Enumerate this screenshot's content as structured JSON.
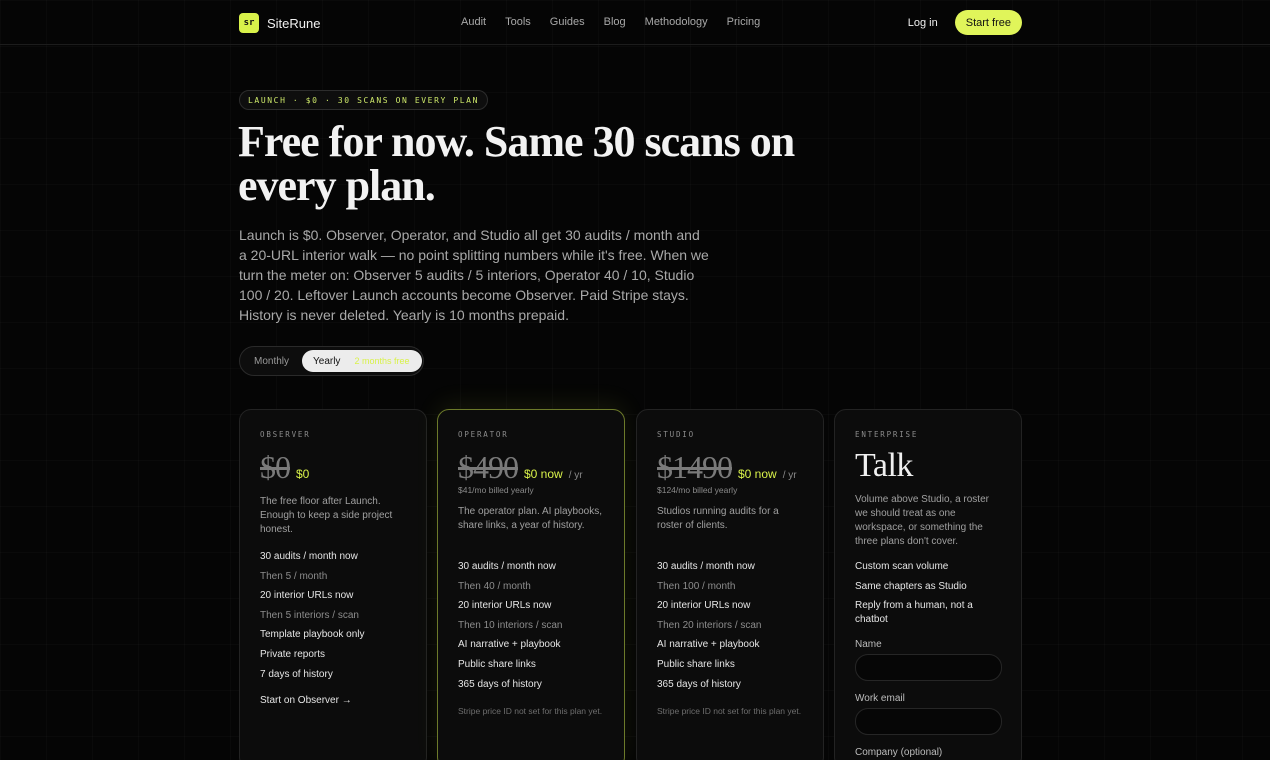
{
  "nav": {
    "logo_text": "sr",
    "brand": "SiteRune",
    "links": [
      "Audit",
      "Tools",
      "Guides",
      "Blog",
      "Methodology",
      "Pricing"
    ],
    "login": "Log in",
    "cta": "Start free"
  },
  "hero": {
    "pill": "LAUNCH · $0 · 30 SCANS ON EVERY PLAN",
    "title": "Free for now. Same 30 scans on every plan.",
    "lead": "Launch is $0. Observer, Operator, and Studio all get 30 audits / month and a 20-URL interior walk — no point splitting numbers while it's free. When we turn the meter on: Observer 5 audits / 5 interiors, Operator 40 / 10, Studio 100 / 20. Leftover Launch accounts become Observer. Paid Stripe stays. History is never deleted. Yearly is 10 months prepaid."
  },
  "toggle": {
    "monthly": "Monthly",
    "yearly": "Yearly",
    "yearly_note": "2 months free",
    "selected": "Yearly"
  },
  "plans": [
    {
      "label": "OBSERVER",
      "price_old": "$0",
      "price_now": "$0",
      "per": "",
      "billed": "",
      "desc": "The free floor after Launch. Enough to keep a side project honest.",
      "features": [
        {
          "text": "30 audits / month now",
          "dim": false
        },
        {
          "text": "Then 5 / month",
          "dim": true
        },
        {
          "text": "20 interior URLs now",
          "dim": false
        },
        {
          "text": "Then 5 interiors / scan",
          "dim": true
        },
        {
          "text": "Template playbook only",
          "dim": false
        },
        {
          "text": "Private reports",
          "dim": false
        },
        {
          "text": "7 days of history",
          "dim": false
        }
      ],
      "cta": "Start on Observer →",
      "note": ""
    },
    {
      "label": "OPERATOR",
      "price_old": "$490",
      "price_now": "$0 now",
      "per": "/ yr",
      "billed": "$41/mo billed yearly",
      "desc": "The operator plan. AI playbooks, share links, a year of history.",
      "features": [
        {
          "text": "30 audits / month now",
          "dim": false
        },
        {
          "text": "Then 40 / month",
          "dim": true
        },
        {
          "text": "20 interior URLs now",
          "dim": false
        },
        {
          "text": "Then 10 interiors / scan",
          "dim": true
        },
        {
          "text": "AI narrative + playbook",
          "dim": false
        },
        {
          "text": "Public share links",
          "dim": false
        },
        {
          "text": "365 days of history",
          "dim": false
        }
      ],
      "cta": "",
      "note": "Stripe price ID not set for this plan yet."
    },
    {
      "label": "STUDIO",
      "price_old": "$1490",
      "price_now": "$0 now",
      "per": "/ yr",
      "billed": "$124/mo billed yearly",
      "desc": "Studios running audits for a roster of clients.",
      "features": [
        {
          "text": "30 audits / month now",
          "dim": false
        },
        {
          "text": "Then 100 / month",
          "dim": true
        },
        {
          "text": "20 interior URLs now",
          "dim": false
        },
        {
          "text": "Then 20 interiors / scan",
          "dim": true
        },
        {
          "text": "AI narrative + playbook",
          "dim": false
        },
        {
          "text": "Public share links",
          "dim": false
        },
        {
          "text": "365 days of history",
          "dim": false
        }
      ],
      "cta": "",
      "note": "Stripe price ID not set for this plan yet."
    }
  ],
  "enterprise": {
    "label": "ENTERPRISE",
    "title": "Talk",
    "desc": "Volume above Studio, a roster we should treat as one workspace, or something the three plans don't cover.",
    "features": [
      "Custom scan volume",
      "Same chapters as Studio",
      "Reply from a human, not a chatbot"
    ],
    "name_label": "Name",
    "email_label": "Work email",
    "company_label": "Company (optional)"
  }
}
